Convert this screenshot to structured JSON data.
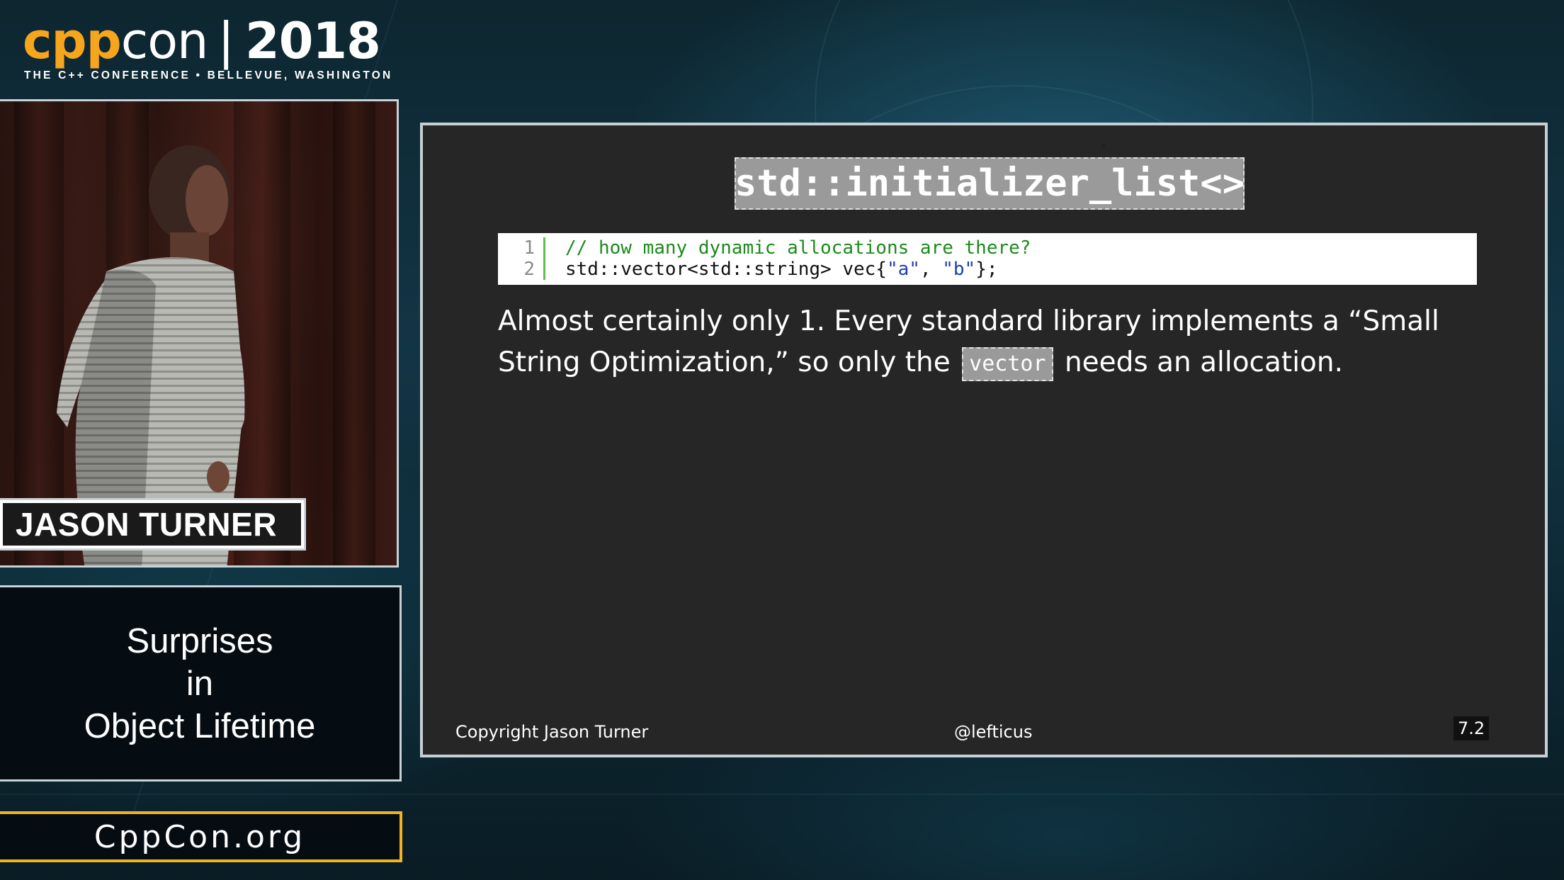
{
  "logo": {
    "cpp": "cpp",
    "con": "con",
    "separator": "|",
    "year": "2018",
    "tagline": "THE C++ CONFERENCE • BELLEVUE, WASHINGTON"
  },
  "speaker": {
    "name": "JASON TURNER"
  },
  "talk": {
    "title_lines": [
      "Surprises",
      "in",
      "Object Lifetime"
    ]
  },
  "website": "CppCon.org",
  "slide": {
    "title": "std::initializer_list<>",
    "code": {
      "line_numbers": [
        "1",
        "2"
      ],
      "line1_comment": "// how many dynamic allocations are there?",
      "line2_part1": "std::vector<std::string> vec{",
      "line2_str_a": "\"a\"",
      "line2_comma": ", ",
      "line2_str_b": "\"b\"",
      "line2_end": "};"
    },
    "body": {
      "before_code": "Almost certainly only 1. Every standard library implements a “Small String Optimization,” so only the",
      "inline_code": "vector",
      "after_code": "needs an allocation."
    },
    "footer": {
      "copyright": "Copyright Jason Turner",
      "handle": "@lefticus",
      "slide_number": "7.2"
    }
  },
  "colors": {
    "brand_orange": "#f6a61c",
    "website_border": "#f3b125",
    "slide_bg": "#262626",
    "code_comment": "#1c8a1c",
    "code_string": "#1a3fb0"
  }
}
